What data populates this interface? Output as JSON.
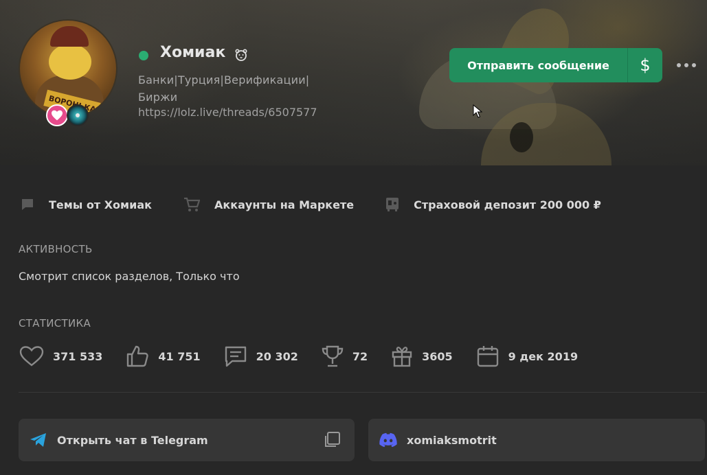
{
  "profile": {
    "username": "Хомиак",
    "title_line1": "Банки|Турция|Верификации|",
    "title_line2": "Биржи",
    "link": "https://lolz.live/threads/6507577",
    "avatar_sign": "ВОРОНЬКА",
    "online": true,
    "online_color": "#2bad72"
  },
  "actions": {
    "send_message": "Отправить сообщение",
    "money_symbol": "$",
    "more_icon": "ellipsis-icon",
    "accent_color": "#228e5d"
  },
  "links": [
    {
      "label": "Темы от Хомиак",
      "icon": "comment-icon"
    },
    {
      "label": "Аккаунты на Маркете",
      "icon": "cart-icon"
    },
    {
      "label": "Страховой депозит 200 000 ₽",
      "icon": "safe-icon"
    }
  ],
  "activity": {
    "title": "АКТИВНОСТЬ",
    "text": "Смотрит список разделов, Только что"
  },
  "stats": {
    "title": "СТАТИСТИКА",
    "items": [
      {
        "icon": "heart-icon",
        "value": "371 533"
      },
      {
        "icon": "thumbs-up-icon",
        "value": "41 751"
      },
      {
        "icon": "messages-icon",
        "value": "20 302"
      },
      {
        "icon": "trophy-icon",
        "value": "72"
      },
      {
        "icon": "gift-icon",
        "value": "3605"
      },
      {
        "icon": "calendar-icon",
        "value": "9 дек 2019"
      }
    ]
  },
  "contacts": {
    "telegram": {
      "label": "Открыть чат в Telegram",
      "icon": "telegram-icon",
      "color": "#2aa3dd"
    },
    "discord": {
      "label": "xomiaksmotrit",
      "icon": "discord-icon",
      "color": "#5865f2"
    }
  }
}
